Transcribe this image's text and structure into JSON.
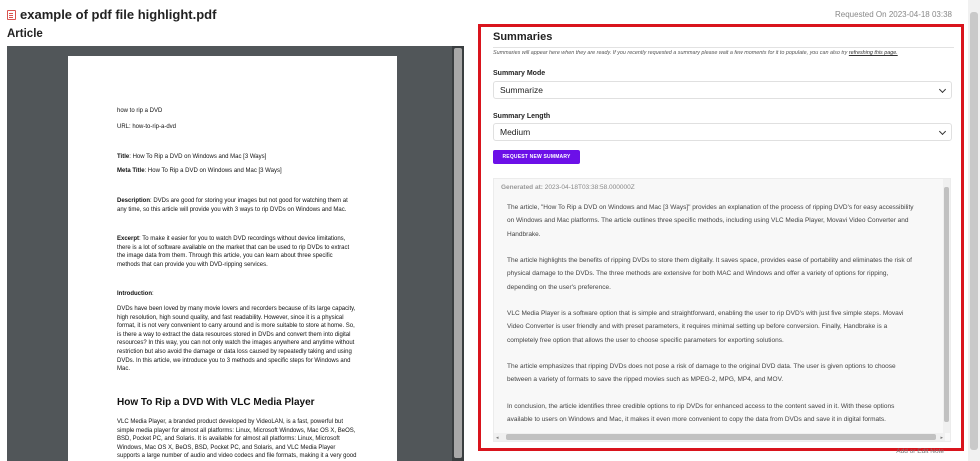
{
  "header": {
    "file_title": "example of pdf file highlight.pdf",
    "requested_label": "Requested On",
    "requested_date": "2023-04-18 03:38"
  },
  "article": {
    "heading": "Article",
    "pdf_lines": [
      "how to rip a DVD",
      "URL: how-to-rip-a-dvd"
    ],
    "title_label": "Title",
    "title_value": ": How To Rip a DVD on Windows and Mac [3 Ways]",
    "meta_title_label": "Meta Title",
    "meta_title_value": ": How To Rip a DVD on Windows and Mac [3 Ways]",
    "description_label": "Description",
    "description_lines": [
      ": DVDs are good for storing your images but not good for watching them at",
      "any time, so this article will provide you with 3 ways to rip DVDs on Windows and Mac."
    ],
    "excerpt_label": "Excerpt",
    "excerpt_lines": [
      ": To make it easier for you to watch DVD recordings without device limitations,",
      "there is a lot of software available on the market that can be used to rip DVDs to extract",
      "the image data from them. Through this article, you can learn about three specific",
      "methods that can provide you with DVD-ripping services."
    ],
    "introduction_label": "Introduction",
    "introduction_lines": [
      "DVDs have been loved by many movie lovers and recorders because of its large capacity,",
      "high resolution, high sound quality, and fast readability. However, since it is a physical",
      "format, it is not very convenient to carry around and is more suitable to store at home. So,",
      "is there a way to extract the data resources stored in DVDs and convert them into digital",
      "resources? In this way, you can not only watch the images anywhere and anytime without",
      "restriction but also avoid the damage or data loss caused by repeatedly taking and using",
      "DVDs. In this article, we introduce you to 3 methods and specific steps for Windows and",
      "Mac."
    ],
    "section_heading": "How To Rip a DVD With VLC Media Player",
    "section_lines": [
      "VLC Media Player, a branded product developed by VideoLAN, is a fast, powerful but",
      "simple media player for almost all platforms: Linux, Microsoft Windows, Mac OS X, BeOS,",
      "BSD, Pocket PC, and Solaris. It is available for almost all platforms: Linux, Microsoft",
      "Windows, Mac OS X, BeOS, BSD, Pocket PC, and Solaris, and VLC Media Player",
      "supports a large number of audio and video codecs and file formats, making it a very good"
    ]
  },
  "summaries": {
    "title": "Summaries",
    "notice": "Summaries will appear here when they are ready. If you recently requested a summary please wait a few moments for it to populate, you can also try",
    "notice_link": "refreshing this page.",
    "mode_label": "Summary Mode",
    "mode_value": "Summarize",
    "length_label": "Summary Length",
    "length_value": "Medium",
    "request_button": "REQUEST NEW SUMMARY",
    "generated_label": "Generated at:",
    "generated_value": "2023-04-18T03:38:58.000000Z",
    "paragraphs": [
      [
        "The article, \"How To Rip a DVD on Windows and Mac [3 Ways]\" provides an explanation of the process of ripping DVD's for easy accessibility",
        "on Windows and Mac platforms. The article outlines three specific methods, including using VLC Media Player, Movavi Video Converter and",
        "Handbrake."
      ],
      [
        "The article highlights the benefits of ripping DVDs to store them digitally. It saves space, provides ease of portability and eliminates the risk of",
        "physical damage to the DVDs. The three methods are extensive for both MAC and Windows and offer a variety of options for ripping,",
        "depending on the user's preference."
      ],
      [
        "VLC Media Player is a software option that is simple and straightforward, enabling the user to rip DVD's with just five simple steps. Movavi",
        "Video Converter is user friendly and with preset parameters, it requires minimal setting up before conversion. Finally, Handbrake is a",
        "completely free option that allows the user to choose specific parameters for exporting solutions."
      ],
      [
        "The article emphasizes that ripping DVDs does not pose a risk of damage to the original DVD data. The user is given options to choose",
        "between a variety of formats to save the ripped movies such as MPEG-2, MPG, MP4, and MOV."
      ],
      [
        "In conclusion, the article identifies three credible options to rip DVDs for enhanced access to the content saved in it. With these options",
        "available to users on Windows and Mac, it makes it even more convenient to copy the data from DVDs and save it in digital formats."
      ]
    ]
  },
  "footer": {
    "partial_text": "Add or Edit Note"
  },
  "colors": {
    "highlight_border": "#d9141d",
    "button_bg": "#6c10e8",
    "file_icon": "#d9534f"
  }
}
